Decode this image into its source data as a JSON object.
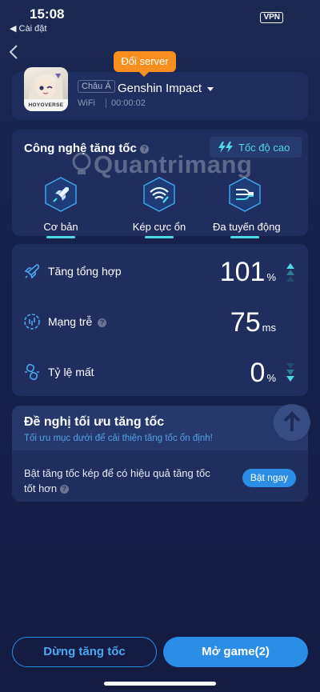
{
  "status_bar": {
    "time": "15:08",
    "back_app": "◀ Cài đặt",
    "vpn": "VPN"
  },
  "server_tag": "Đổi server",
  "game": {
    "avatar_brand": "HOYOVERSE",
    "region": "Châu Á",
    "name": "Genshin Impact",
    "network": "WiFi",
    "elapsed": "00:00:02"
  },
  "tech": {
    "title": "Công nghệ tăng tốc",
    "speed_label": "Tốc độ cao",
    "modes": [
      {
        "label": "Cơ bản",
        "icon": "rocket-icon"
      },
      {
        "label": "Kép cực ổn",
        "icon": "wifi-double-icon"
      },
      {
        "label": "Đa tuyến động",
        "icon": "multi-route-icon"
      }
    ]
  },
  "stats": [
    {
      "label": "Tăng tổng hợp",
      "value": "101",
      "unit": "%",
      "trend": "up",
      "icon": "rocket-icon"
    },
    {
      "label": "Mạng trễ",
      "value": "75",
      "unit": "ms",
      "trend": "none",
      "icon": "latency-icon"
    },
    {
      "label": "Tỷ lệ mất",
      "value": "0",
      "unit": "%",
      "trend": "down",
      "icon": "packet-loss-icon"
    }
  ],
  "optimize": {
    "title": "Đề nghị tối ưu tăng tốc",
    "subtitle": "Tối ưu mục dưới để cải thiện tăng tốc ổn định!",
    "suggestion": "Bật tăng tốc kép để có hiệu quả tăng tốc tốt hơn",
    "action": "Bật ngay"
  },
  "bottom": {
    "stop": "Dừng tăng tốc",
    "open": "Mở game(2)"
  },
  "watermark": "Quantrimang",
  "colors": {
    "accent": "#2a8de6",
    "cyan": "#4fd8e6",
    "orange": "#f68f1e",
    "background": "#1a2852"
  }
}
